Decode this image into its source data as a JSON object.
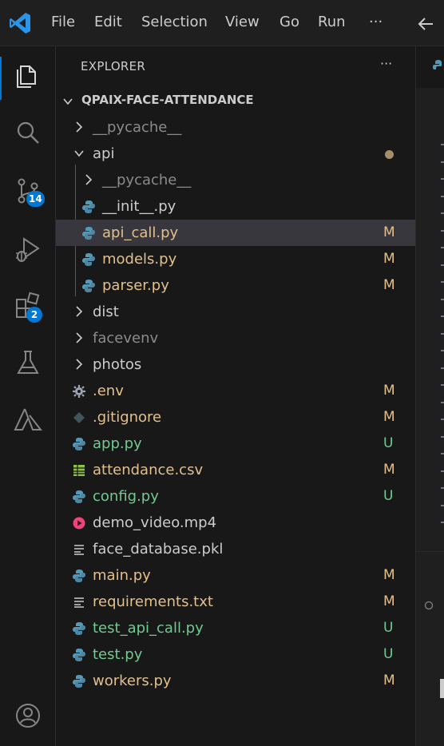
{
  "menu": {
    "items": [
      "File",
      "Edit",
      "Selection",
      "View",
      "Go",
      "Run",
      "···"
    ],
    "back_icon": "arrow-left-icon"
  },
  "activity_bar": {
    "items": [
      {
        "icon": "explorer-icon",
        "active": true
      },
      {
        "icon": "search-icon"
      },
      {
        "icon": "source-control-icon",
        "badge": "14"
      },
      {
        "icon": "run-debug-icon"
      },
      {
        "icon": "extensions-icon",
        "badge": "2"
      },
      {
        "icon": "testing-icon"
      },
      {
        "icon": "azure-icon"
      }
    ],
    "bottom": {
      "icon": "account-icon"
    }
  },
  "explorer": {
    "title": "EXPLORER",
    "more": "···",
    "project": "QPAIX-FACE-ATTENDANCE",
    "rows": [
      {
        "label": "__pycache__",
        "type": "folder",
        "expanded": false,
        "depth": 0,
        "color": "#8b8b8b"
      },
      {
        "label": "api",
        "type": "folder",
        "expanded": true,
        "depth": 0,
        "color": "#cccccc",
        "status_dot": true
      },
      {
        "label": "__pycache__",
        "type": "folder",
        "expanded": false,
        "depth": 1,
        "color": "#8b8b8b"
      },
      {
        "label": "__init__.py",
        "type": "python",
        "depth": 1,
        "color": "#cccccc"
      },
      {
        "label": "api_call.py",
        "type": "python",
        "depth": 1,
        "color": "#e2c08d",
        "status": "M",
        "selected": true
      },
      {
        "label": "models.py",
        "type": "python",
        "depth": 1,
        "color": "#e2c08d",
        "status": "M"
      },
      {
        "label": "parser.py",
        "type": "python",
        "depth": 1,
        "color": "#e2c08d",
        "status": "M"
      },
      {
        "label": "dist",
        "type": "folder",
        "expanded": false,
        "depth": 0,
        "color": "#cccccc"
      },
      {
        "label": "facevenv",
        "type": "folder",
        "expanded": false,
        "depth": 0,
        "color": "#8b8b8b"
      },
      {
        "label": "photos",
        "type": "folder",
        "expanded": false,
        "depth": 0,
        "color": "#cccccc"
      },
      {
        "label": ".env",
        "type": "gear",
        "depth": 0,
        "color": "#e2c08d",
        "status": "M"
      },
      {
        "label": ".gitignore",
        "type": "git",
        "depth": 0,
        "color": "#e2c08d",
        "status": "M"
      },
      {
        "label": "app.py",
        "type": "python",
        "depth": 0,
        "color": "#73c991",
        "status": "U"
      },
      {
        "label": "attendance.csv",
        "type": "csv",
        "depth": 0,
        "color": "#e2c08d",
        "status": "M"
      },
      {
        "label": "config.py",
        "type": "python",
        "depth": 0,
        "color": "#73c991",
        "status": "U"
      },
      {
        "label": "demo_video.mp4",
        "type": "video",
        "depth": 0,
        "color": "#cccccc"
      },
      {
        "label": "face_database.pkl",
        "type": "text",
        "depth": 0,
        "color": "#cccccc"
      },
      {
        "label": "main.py",
        "type": "python",
        "depth": 0,
        "color": "#e2c08d",
        "status": "M"
      },
      {
        "label": "requirements.txt",
        "type": "text",
        "depth": 0,
        "color": "#e2c08d",
        "status": "M"
      },
      {
        "label": "test_api_call.py",
        "type": "python",
        "depth": 0,
        "color": "#73c991",
        "status": "U"
      },
      {
        "label": "test.py",
        "type": "python",
        "depth": 0,
        "color": "#73c991",
        "status": "U"
      },
      {
        "label": "workers.py",
        "type": "python",
        "depth": 0,
        "color": "#e2c08d",
        "status": "M"
      }
    ]
  },
  "colors": {
    "accent": "#0078d4",
    "modified": "#e2c08d",
    "untracked": "#73c991",
    "python_icon": "#519aba"
  }
}
